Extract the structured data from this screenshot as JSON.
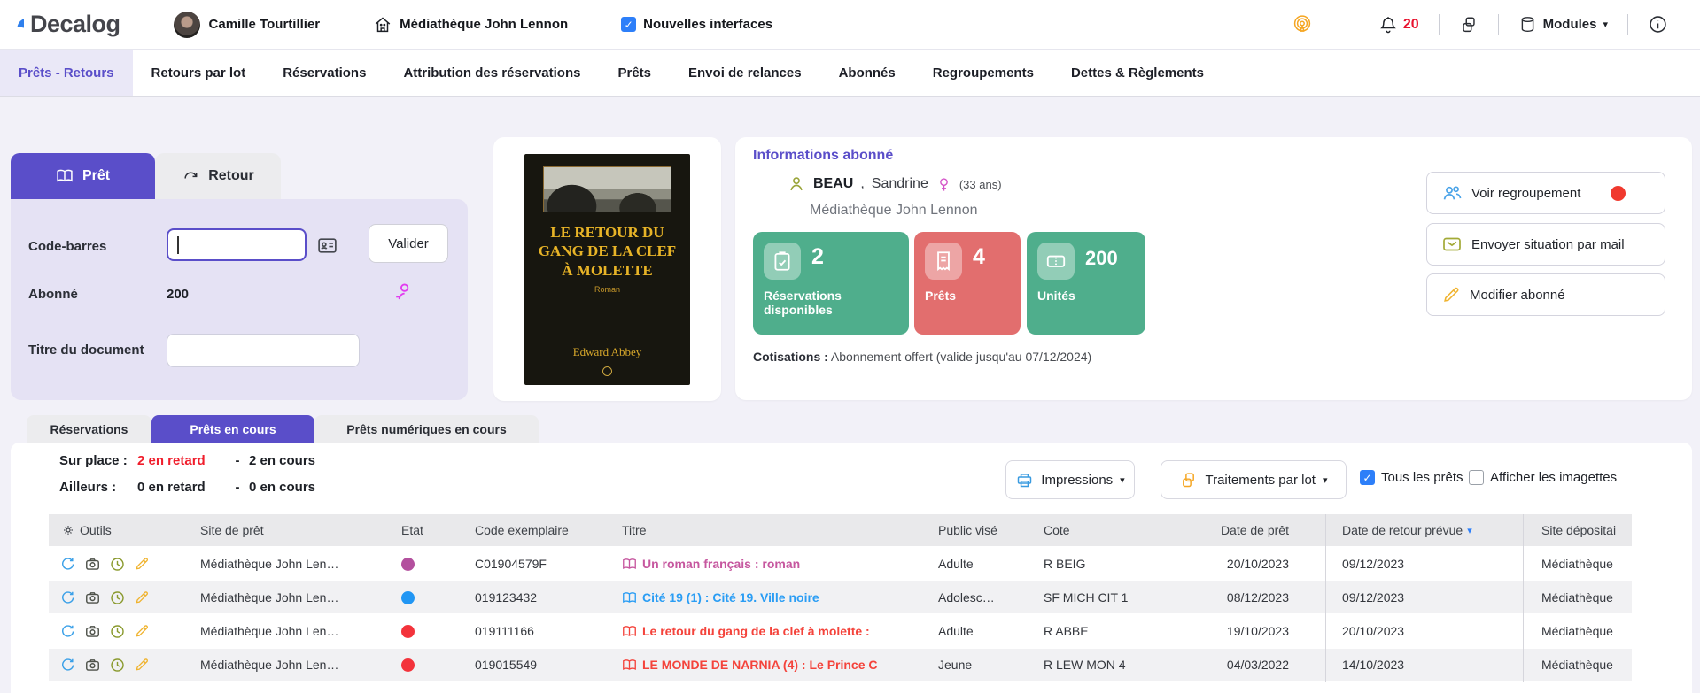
{
  "header": {
    "logo": "Decalog",
    "user_name": "Camille Tourtillier",
    "library": "Médiathèque John Lennon",
    "new_interfaces": {
      "label": "Nouvelles interfaces",
      "checked": true
    },
    "notifications": "20",
    "modules_label": "Modules"
  },
  "icons": {
    "dropdown_caret": "▾",
    "sort_caret": "▾"
  },
  "nav": {
    "tabs": [
      {
        "label": "Prêts - Retours",
        "active": true
      },
      {
        "label": "Retours par lot"
      },
      {
        "label": "Réservations"
      },
      {
        "label": "Attribution des réservations"
      },
      {
        "label": "Prêts"
      },
      {
        "label": "Envoi de relances"
      },
      {
        "label": "Abonnés"
      },
      {
        "label": "Regroupements"
      },
      {
        "label": "Dettes & Règlements"
      }
    ]
  },
  "loan_form": {
    "tabs": [
      {
        "label": "Prêt",
        "active": true
      },
      {
        "label": "Retour"
      }
    ],
    "barcode_label": "Code-barres",
    "validate_button": "Valider",
    "patron_label": "Abonné",
    "patron_value": "200",
    "title_label": "Titre du document"
  },
  "book_cover": {
    "title": "LE RETOUR DU GANG DE LA CLEF À MOLETTE",
    "subtitle": "Roman",
    "author": "Edward Abbey"
  },
  "patron_info": {
    "section_title": "Informations abonné",
    "last_name": "BEAU",
    "name_separator": ",",
    "first_name": "Sandrine",
    "age": "(33 ans)",
    "library": "Médiathèque John Lennon",
    "stats": [
      {
        "value": "2",
        "label": "Réservations disponibles",
        "color": "#4fae8c"
      },
      {
        "value": "4",
        "label": "Prêts",
        "color": "#e26e6e"
      },
      {
        "value": "200",
        "label": "Unités",
        "color": "#4fae8c"
      }
    ],
    "cotisations_label": "Cotisations :",
    "cotisations_value": "Abonnement offert (valide jusqu'au 07/12/2024)",
    "actions": [
      "Voir regroupement",
      "Envoyer situation par mail",
      "Modifier abonné"
    ]
  },
  "loans": {
    "tabs": [
      {
        "label": "Réservations"
      },
      {
        "label": "Prêts en cours",
        "active": true
      },
      {
        "label": "Prêts numériques en cours"
      }
    ],
    "status": {
      "onsite_label": "Sur place :",
      "onsite_late": "2 en retard",
      "onsite_current": "2 en cours",
      "elsewhere_label": "Ailleurs :",
      "elsewhere_late": "0 en retard",
      "elsewhere_current": "0 en cours",
      "separator": "-"
    },
    "toolbar": {
      "print_button": "Impressions",
      "batch_button": "Traitements par lot",
      "all_loans": {
        "label": "Tous les prêts",
        "checked": true
      },
      "show_thumbnails": {
        "label": "Afficher les imagettes",
        "checked": false
      }
    },
    "table": {
      "headers": {
        "tools": "Outils",
        "site": "Site de prêt",
        "state": "Etat",
        "code": "Code exemplaire",
        "title": "Titre",
        "audience": "Public visé",
        "callnum": "Cote",
        "loan_date": "Date de prêt",
        "due_date": "Date de retour prévue",
        "deposit_site": "Site dépositai"
      },
      "rows": [
        {
          "site": "Médiathèque John Len…",
          "state_color": "#b3509e",
          "code": "C01904579F",
          "title": "Un roman français : roman",
          "title_color": "#c6579f",
          "audience": "Adulte",
          "callnum": "R BEIG",
          "loan_date": "20/10/2023",
          "due_date": "09/12/2023",
          "deposit_site": "Médiathèque"
        },
        {
          "site": "Médiathèque John Len…",
          "state_color": "#2196f3",
          "code": "019123432",
          "title": "Cité 19 (1) : Cité 19. Ville noire",
          "title_color": "#2a9df4",
          "audience": "Adolesc…",
          "callnum": "SF MICH CIT 1",
          "loan_date": "08/12/2023",
          "due_date": "09/12/2023",
          "deposit_site": "Médiathèque"
        },
        {
          "site": "Médiathèque John Len…",
          "state_color": "#f3333b",
          "code": "019111166",
          "title": "Le retour du gang de la clef à molette :",
          "title_color": "#f4433b",
          "audience": "Adulte",
          "callnum": "R ABBE",
          "loan_date": "19/10/2023",
          "due_date": "20/10/2023",
          "deposit_site": "Médiathèque"
        },
        {
          "site": "Médiathèque John Len…",
          "state_color": "#f3333b",
          "code": "019015549",
          "title": "LE MONDE DE NARNIA (4) : Le Prince C",
          "title_color": "#f4433b",
          "audience": "Jeune",
          "callnum": "R LEW MON 4",
          "loan_date": "04/03/2022",
          "due_date": "14/10/2023",
          "deposit_site": "Médiathèque"
        }
      ]
    }
  }
}
